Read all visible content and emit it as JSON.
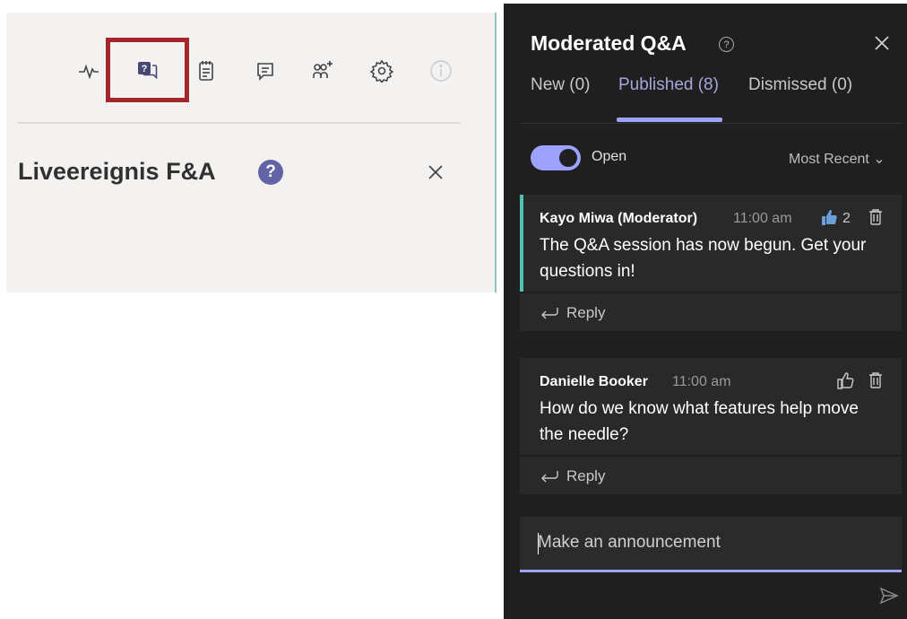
{
  "left": {
    "title": "Liveereignis F&A",
    "help_glyph": "?",
    "toolbar": [
      "pulse-icon",
      "qa-icon",
      "notes-icon",
      "chat-icon",
      "attendees-icon",
      "settings-icon",
      "info-icon"
    ],
    "highlight_color": "#a4262c"
  },
  "qa": {
    "title": "Moderated Q&A",
    "help_glyph": "?",
    "tabs": [
      {
        "label": "New (0)"
      },
      {
        "label": "Published (8)"
      },
      {
        "label": "Dismissed (0)"
      }
    ],
    "active_tab": "Published (8)",
    "toggle_label": "Open",
    "toggle_on": true,
    "sort_label": "Most Recent",
    "messages": [
      {
        "author": "Kayo Miwa (Moderator)",
        "time": "11:00 am",
        "likes": "2",
        "text": "The Q&A session has now begun. Get your questions in!",
        "reply_label": "Reply"
      },
      {
        "author": "Danielle Booker",
        "time": "11:00 am",
        "text": "How do we know what features help move the needle?",
        "reply_label": "Reply"
      }
    ],
    "announcement_placeholder": "Make an announcement",
    "accent_color": "#9ea2ff"
  }
}
